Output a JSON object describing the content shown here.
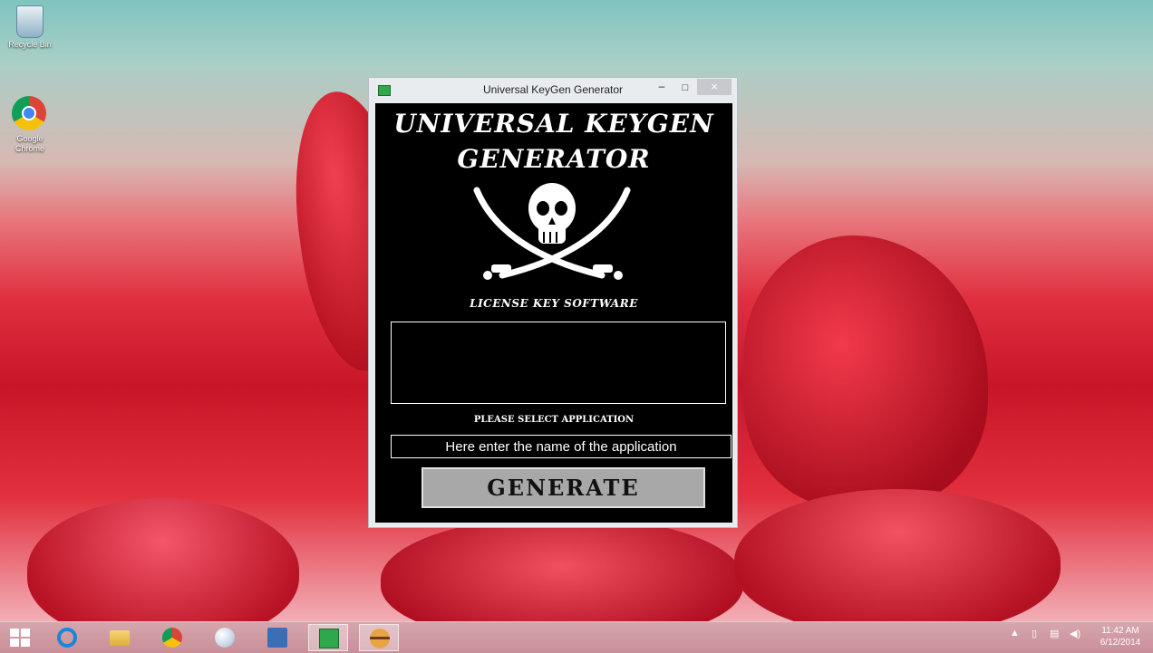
{
  "desktop": {
    "icons": [
      {
        "label": "Recycle Bin"
      },
      {
        "label": "Google Chrome"
      }
    ]
  },
  "window": {
    "title": "Universal KeyGen Generator",
    "minimize_label": "–",
    "maximize_label": "□",
    "close_label": "×",
    "banner_line1": "UNIVERSAL KEYGEN",
    "banner_line2": "GENERATOR",
    "subtitle": "LICENSE KEY SOFTWARE",
    "select_label": "PLEASE SELECT APPLICATION",
    "app_input_placeholder": "Here enter the name of the application",
    "generate_label": "GENERATE"
  },
  "taskbar": {
    "apps": [
      "start-icon",
      "internet-explorer-icon",
      "file-explorer-icon",
      "chrome-icon",
      "paint-icon",
      "network-icon",
      "keygen-icon",
      "burger-app-icon"
    ],
    "tray_icons": [
      "show-hidden-icon",
      "battery-icon",
      "network-tray-icon",
      "volume-icon"
    ],
    "time": "11:42 AM",
    "date": "6/12/2014"
  }
}
